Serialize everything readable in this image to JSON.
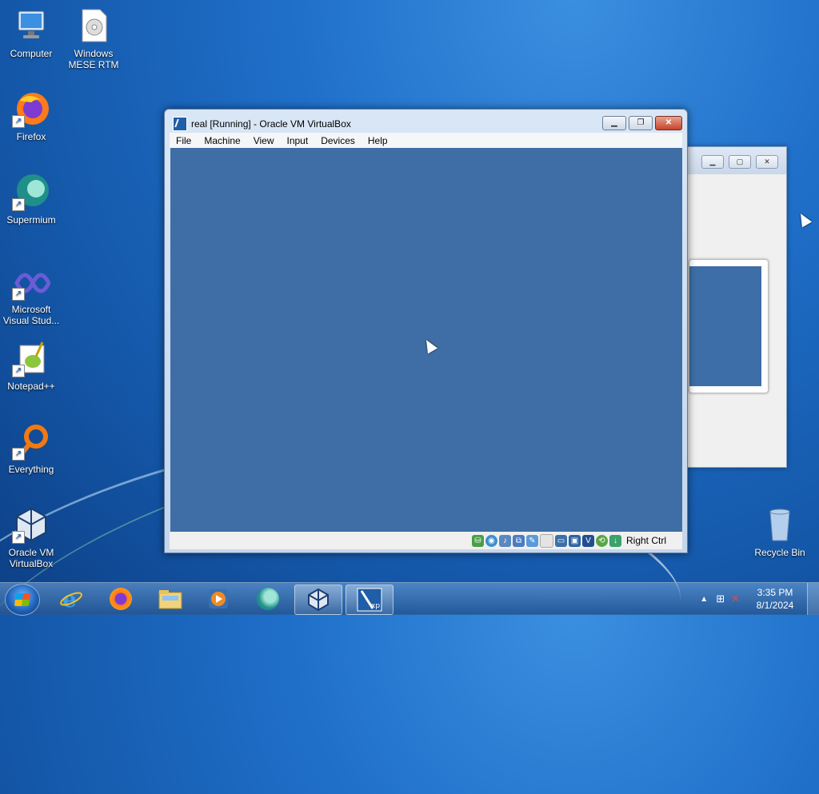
{
  "desktop": {
    "icons": [
      {
        "label": "Computer",
        "icon": "computer-icon"
      },
      {
        "label": "Windows MESE RTM",
        "icon": "disc-image-icon"
      },
      {
        "label": "Firefox",
        "icon": "firefox-icon"
      },
      {
        "label": "Supermium",
        "icon": "supermium-icon"
      },
      {
        "label": "Microsoft Visual Stud...",
        "icon": "visual-studio-icon"
      },
      {
        "label": "Notepad++",
        "icon": "notepad-plus-plus-icon"
      },
      {
        "label": "Everything",
        "icon": "everything-search-icon"
      },
      {
        "label": "Oracle VM VirtualBox",
        "icon": "virtualbox-icon"
      },
      {
        "label": "Recycle Bin",
        "icon": "recycle-bin-icon"
      }
    ]
  },
  "vbox_window": {
    "title": "real [Running] - Oracle VM VirtualBox",
    "menu": [
      "File",
      "Machine",
      "View",
      "Input",
      "Devices",
      "Help"
    ],
    "screen_color": "#3f6ea6",
    "host_key_label": "Right Ctrl"
  },
  "taskbar": {
    "items": [
      "internet-explorer-icon",
      "firefox-icon",
      "file-explorer-icon",
      "media-player-icon",
      "supermium-icon",
      "virtualbox-icon",
      "virtual-machine-xp-icon"
    ],
    "clock_time": "3:35 PM",
    "clock_date": "8/1/2024"
  },
  "colors": {
    "accent": "#1f6fc9",
    "close_button": "#c6442c"
  }
}
